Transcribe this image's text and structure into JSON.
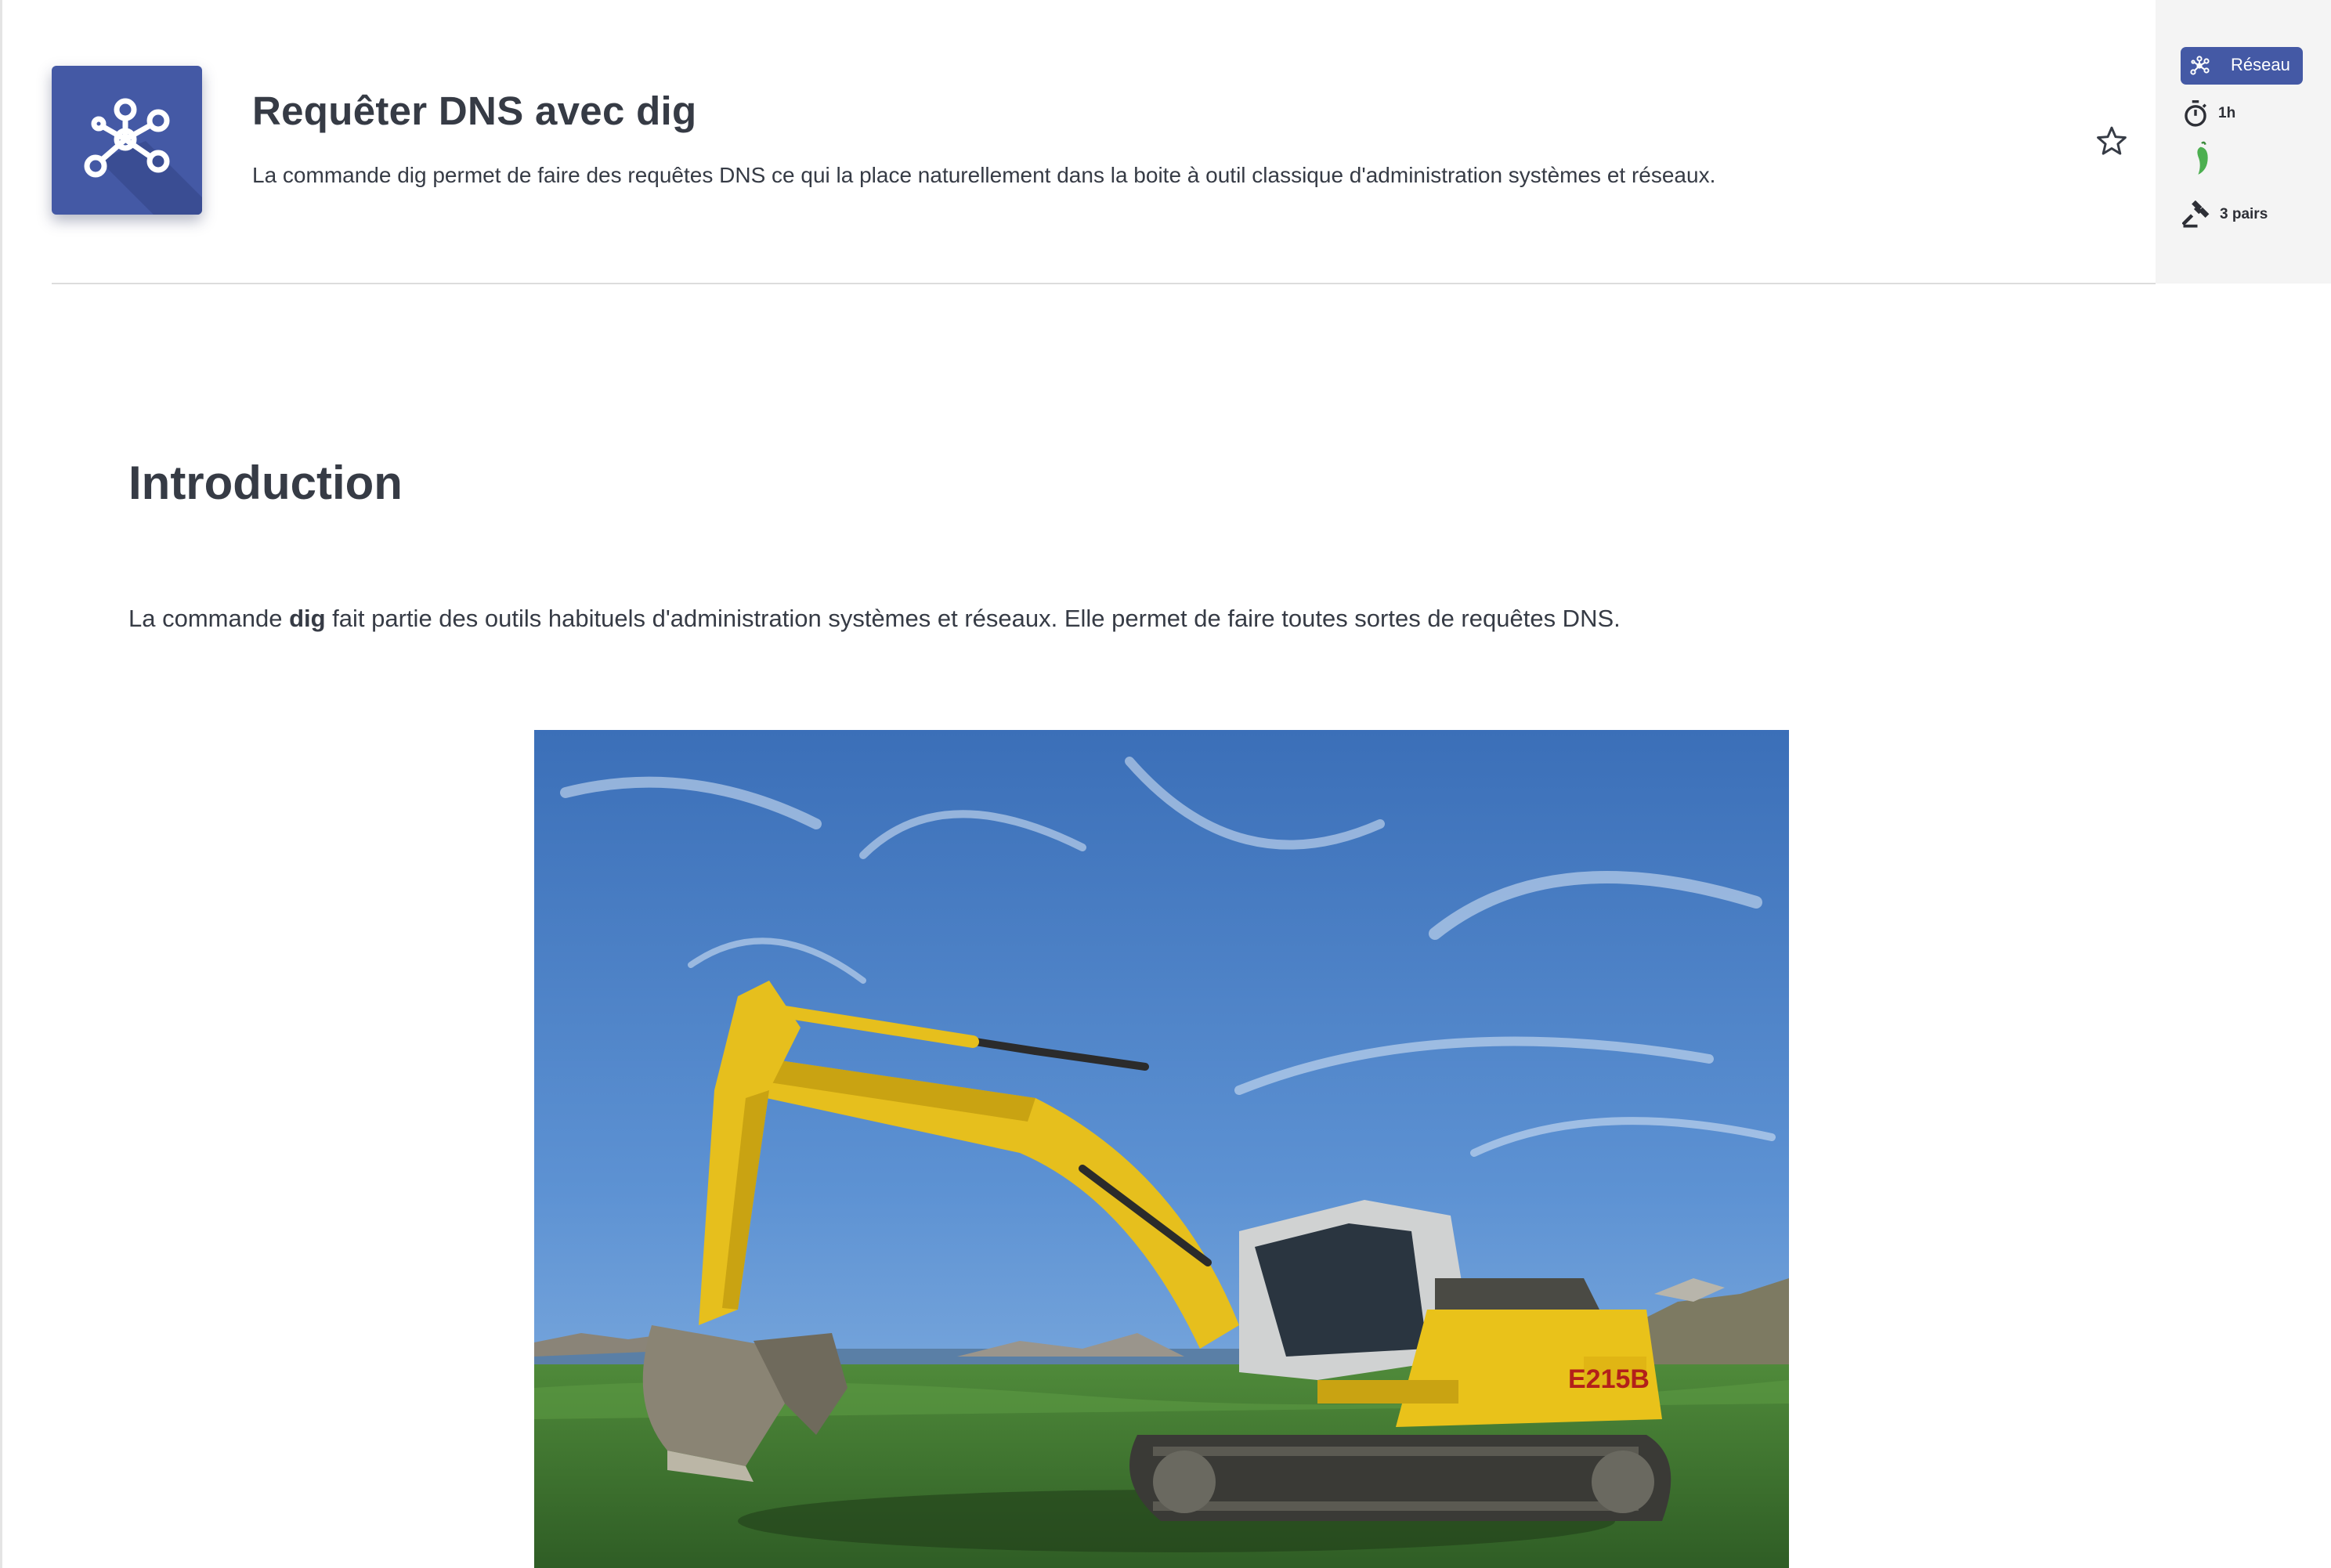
{
  "header": {
    "title": "Requêter DNS avec dig",
    "description": "La commande dig permet de faire des requêtes DNS ce qui la place naturellement dans la boite à outil classique d'administration systèmes et réseaux.",
    "logo_icon": "network-nodes-icon",
    "favorite_icon": "star-outline-icon"
  },
  "meta": {
    "category_label": "Réseau",
    "category_icon": "network-nodes-icon",
    "duration": "1h",
    "duration_icon": "stopwatch-icon",
    "difficulty_icon": "green-chili-icon",
    "review_label": "3 pairs",
    "review_icon": "gavel-icon"
  },
  "content": {
    "section_title": "Introduction",
    "paragraph_before": "La commande ",
    "paragraph_bold": "dig",
    "paragraph_after": " fait partie des outils habituels d'administration systèmes et réseaux. Elle permet de faire toutes sortes de requêtes DNS.",
    "image_subject": "yellow excavator on grass under blue sky",
    "excavator_model": "E215B"
  },
  "colors": {
    "accent": "#4459a5",
    "text": "#363b45",
    "panel": "#f4f4f4",
    "chili": "#4caf50"
  }
}
